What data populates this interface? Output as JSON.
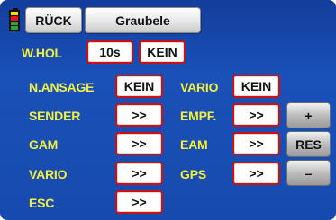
{
  "header": {
    "back_label": "RÜCK",
    "title": "Graubele"
  },
  "battery": {
    "icon": "battery-icon",
    "colors": [
      "#f0e100",
      "#e2131a",
      "#2ba338",
      "#2ba338"
    ]
  },
  "whol": {
    "label": "W.HOL",
    "value": "10s",
    "mode": "KEIN"
  },
  "left_column": [
    {
      "label": "N.ANSAGE",
      "value": "KEIN"
    },
    {
      "label": "SENDER",
      "value": ">>"
    },
    {
      "label": "GAM",
      "value": ">>"
    },
    {
      "label": "VARIO",
      "value": ">>"
    },
    {
      "label": "ESC",
      "value": ">>"
    }
  ],
  "right_column": [
    {
      "label": "VARIO",
      "value": "KEIN"
    },
    {
      "label": "EMPF.",
      "value": ">>"
    },
    {
      "label": "EAM",
      "value": ">>"
    },
    {
      "label": "GPS",
      "value": ">>"
    }
  ],
  "side_buttons": {
    "plus": "+",
    "reset": "RES",
    "minus": "–"
  },
  "colors": {
    "background": "#1a51b8",
    "label": "#f3ef3c",
    "accent_border": "#cc1111"
  }
}
